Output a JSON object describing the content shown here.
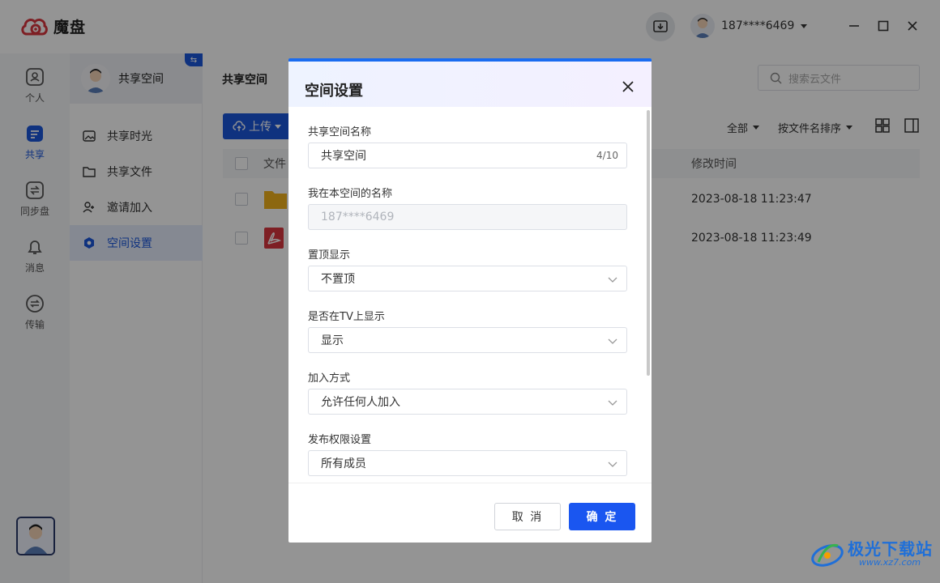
{
  "app": {
    "name": "魔盘"
  },
  "user": {
    "account": "187****6469"
  },
  "left_nav": [
    {
      "label": "个人",
      "icon": "person-icon"
    },
    {
      "label": "共享",
      "icon": "share-icon"
    },
    {
      "label": "同步盘",
      "icon": "sync-icon"
    },
    {
      "label": "消息",
      "icon": "bell-icon"
    },
    {
      "label": "传输",
      "icon": "transfer-icon"
    }
  ],
  "space": {
    "name": "共享空间",
    "switch_glyph": "⇆",
    "menu": [
      {
        "label": "共享时光",
        "icon": "photo-icon"
      },
      {
        "label": "共享文件",
        "icon": "folder-icon"
      },
      {
        "label": "邀请加入",
        "icon": "add-user-icon"
      },
      {
        "label": "空间设置",
        "icon": "settings-icon",
        "active": true
      }
    ]
  },
  "main": {
    "title": "共享空间",
    "search_placeholder": "搜索云文件",
    "upload_label": "上传",
    "filter_all": "全部",
    "sort_label": "按文件名排序",
    "columns": {
      "name": "文件",
      "mtime": "修改时间"
    },
    "rows": [
      {
        "type": "folder",
        "mtime": "2023-08-18 11:23:47"
      },
      {
        "type": "pdf",
        "mtime": "2023-08-18 11:23:49"
      }
    ]
  },
  "dialog": {
    "title": "空间设置",
    "fields": {
      "space_name": {
        "label": "共享空间名称",
        "value": "共享空间",
        "counter": "4/10"
      },
      "my_name": {
        "label": "我在本空间的名称",
        "value": "187****6469"
      },
      "pin": {
        "label": "置顶显示",
        "value": "不置顶"
      },
      "tv": {
        "label": "是否在TV上显示",
        "value": "显示"
      },
      "join": {
        "label": "加入方式",
        "value": "允许任何人加入"
      },
      "publish": {
        "label": "发布权限设置",
        "value": "所有成员"
      }
    },
    "cancel_label": "取 消",
    "ok_label": "确 定"
  },
  "watermark": {
    "cn": "极光下载站",
    "en": "www.xz7.com"
  },
  "colors": {
    "accent": "#1a56db",
    "dialog_top": "#1a6cf0"
  }
}
